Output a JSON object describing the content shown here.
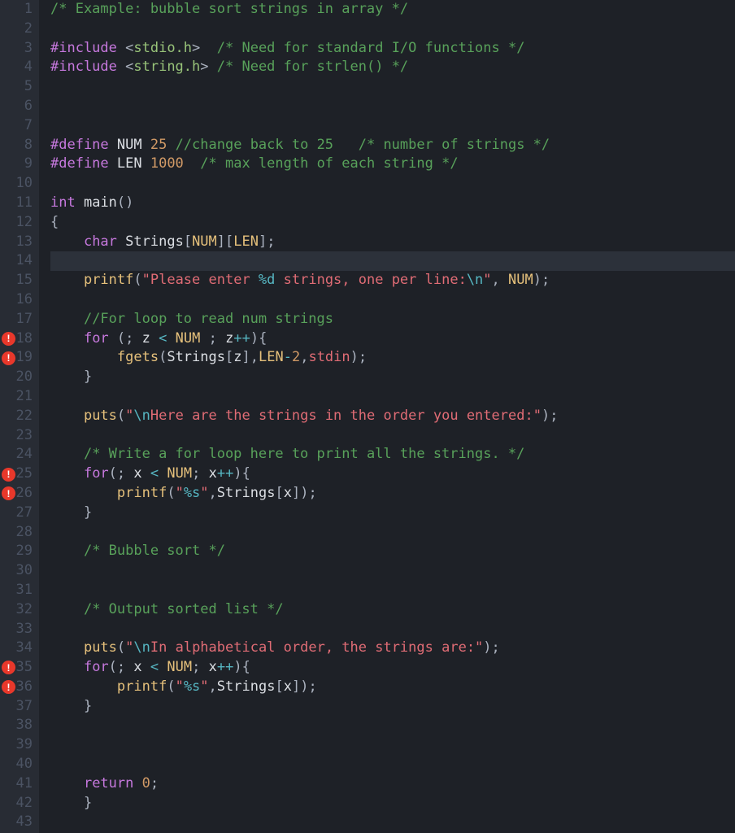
{
  "gutter": {
    "start": 1,
    "end": 43,
    "error_lines": [
      18,
      19,
      25,
      26,
      35,
      36
    ]
  },
  "cursor_line": 14,
  "code": {
    "lines": [
      {
        "n": 1,
        "t": [
          [
            "cmg",
            "/* Example: bubble sort strings in array */"
          ]
        ]
      },
      {
        "n": 2,
        "t": []
      },
      {
        "n": 3,
        "t": [
          [
            "kw",
            "#include "
          ],
          [
            "idw",
            "<"
          ],
          [
            "inc",
            "stdio.h"
          ],
          [
            "idw",
            ">"
          ],
          [
            "pw",
            "  "
          ],
          [
            "cmg",
            "/* Need for standard I/O functions */"
          ]
        ]
      },
      {
        "n": 4,
        "t": [
          [
            "kw",
            "#include "
          ],
          [
            "idw",
            "<"
          ],
          [
            "inc",
            "string.h"
          ],
          [
            "idw",
            ">"
          ],
          [
            "pw",
            " "
          ],
          [
            "cmg",
            "/* Need for strlen() */"
          ]
        ]
      },
      {
        "n": 5,
        "t": []
      },
      {
        "n": 6,
        "t": []
      },
      {
        "n": 7,
        "t": []
      },
      {
        "n": 8,
        "t": [
          [
            "kw",
            "#define "
          ],
          [
            "wt",
            "NUM "
          ],
          [
            "num",
            "25"
          ],
          [
            "pw",
            " "
          ],
          [
            "cmg",
            "//change back to 25   /* number of strings */"
          ]
        ]
      },
      {
        "n": 9,
        "t": [
          [
            "kw",
            "#define "
          ],
          [
            "wt",
            "LEN "
          ],
          [
            "num",
            "1000"
          ],
          [
            "pw",
            "  "
          ],
          [
            "cmg",
            "/* max length of each string */"
          ]
        ]
      },
      {
        "n": 10,
        "t": []
      },
      {
        "n": 11,
        "t": [
          [
            "ty",
            "int"
          ],
          [
            "pw",
            " "
          ],
          [
            "wt",
            "main"
          ],
          [
            "brw",
            "()"
          ]
        ]
      },
      {
        "n": 12,
        "t": [
          [
            "brw",
            "{"
          ]
        ]
      },
      {
        "n": 13,
        "t": [
          [
            "pw",
            "    "
          ],
          [
            "ty",
            "char"
          ],
          [
            "pw",
            " "
          ],
          [
            "wt",
            "Strings"
          ],
          [
            "brw",
            "["
          ],
          [
            "fn",
            "NUM"
          ],
          [
            "brw",
            "]["
          ],
          [
            "fn",
            "LEN"
          ],
          [
            "brw",
            "]"
          ],
          [
            "op",
            ";"
          ]
        ]
      },
      {
        "n": 14,
        "t": []
      },
      {
        "n": 15,
        "t": [
          [
            "pw",
            "    "
          ],
          [
            "fn",
            "printf"
          ],
          [
            "brw",
            "("
          ],
          [
            "str",
            "\"Please enter "
          ],
          [
            "esc",
            "%d"
          ],
          [
            "str",
            " strings, one per line:"
          ],
          [
            "esc",
            "\\n"
          ],
          [
            "str",
            "\""
          ],
          [
            "op",
            ", "
          ],
          [
            "fn",
            "NUM"
          ],
          [
            "brw",
            ")"
          ],
          [
            "op",
            ";"
          ]
        ]
      },
      {
        "n": 16,
        "t": []
      },
      {
        "n": 17,
        "t": [
          [
            "pw",
            "    "
          ],
          [
            "cmg",
            "//For loop to read num strings"
          ]
        ]
      },
      {
        "n": 18,
        "t": [
          [
            "pw",
            "    "
          ],
          [
            "kw",
            "for"
          ],
          [
            "pw",
            " "
          ],
          [
            "brw",
            "("
          ],
          [
            "op",
            "; "
          ],
          [
            "wt",
            "z"
          ],
          [
            "pw",
            " "
          ],
          [
            "opc",
            "<"
          ],
          [
            "pw",
            " "
          ],
          [
            "fn",
            "NUM"
          ],
          [
            "pw",
            " "
          ],
          [
            "op",
            "; "
          ],
          [
            "wt",
            "z"
          ],
          [
            "opc",
            "++"
          ],
          [
            "brw",
            ")"
          ],
          [
            "brw",
            "{"
          ]
        ]
      },
      {
        "n": 19,
        "t": [
          [
            "pw",
            "        "
          ],
          [
            "fn",
            "fgets"
          ],
          [
            "brw",
            "("
          ],
          [
            "wt",
            "Strings"
          ],
          [
            "brw",
            "["
          ],
          [
            "wt",
            "z"
          ],
          [
            "brw",
            "]"
          ],
          [
            "op",
            ","
          ],
          [
            "fn",
            "LEN"
          ],
          [
            "opc",
            "-"
          ],
          [
            "num",
            "2"
          ],
          [
            "op",
            ","
          ],
          [
            "id",
            "stdin"
          ],
          [
            "brw",
            ")"
          ],
          [
            "op",
            ";"
          ]
        ]
      },
      {
        "n": 20,
        "t": [
          [
            "pw",
            "    "
          ],
          [
            "brw",
            "}"
          ]
        ]
      },
      {
        "n": 21,
        "t": []
      },
      {
        "n": 22,
        "t": [
          [
            "pw",
            "    "
          ],
          [
            "fn",
            "puts"
          ],
          [
            "brw",
            "("
          ],
          [
            "str",
            "\""
          ],
          [
            "esc",
            "\\n"
          ],
          [
            "str",
            "Here are the strings in the order you entered:\""
          ],
          [
            "brw",
            ")"
          ],
          [
            "op",
            ";"
          ]
        ]
      },
      {
        "n": 23,
        "t": []
      },
      {
        "n": 24,
        "t": [
          [
            "pw",
            "    "
          ],
          [
            "cmg",
            "/* Write a for loop here to print all the strings. */"
          ]
        ]
      },
      {
        "n": 25,
        "t": [
          [
            "pw",
            "    "
          ],
          [
            "kw",
            "for"
          ],
          [
            "brw",
            "("
          ],
          [
            "op",
            "; "
          ],
          [
            "wt",
            "x"
          ],
          [
            "pw",
            " "
          ],
          [
            "opc",
            "<"
          ],
          [
            "pw",
            " "
          ],
          [
            "fn",
            "NUM"
          ],
          [
            "op",
            "; "
          ],
          [
            "wt",
            "x"
          ],
          [
            "opc",
            "++"
          ],
          [
            "brw",
            ")"
          ],
          [
            "brw",
            "{"
          ]
        ]
      },
      {
        "n": 26,
        "t": [
          [
            "pw",
            "        "
          ],
          [
            "fn",
            "printf"
          ],
          [
            "brw",
            "("
          ],
          [
            "str",
            "\""
          ],
          [
            "esc",
            "%s"
          ],
          [
            "str",
            "\""
          ],
          [
            "op",
            ","
          ],
          [
            "wt",
            "Strings"
          ],
          [
            "brw",
            "["
          ],
          [
            "wt",
            "x"
          ],
          [
            "brw",
            "]"
          ],
          [
            "brw",
            ")"
          ],
          [
            "op",
            ";"
          ]
        ]
      },
      {
        "n": 27,
        "t": [
          [
            "pw",
            "    "
          ],
          [
            "brw",
            "}"
          ]
        ]
      },
      {
        "n": 28,
        "t": []
      },
      {
        "n": 29,
        "t": [
          [
            "pw",
            "    "
          ],
          [
            "cmg",
            "/* Bubble sort */"
          ]
        ]
      },
      {
        "n": 30,
        "t": []
      },
      {
        "n": 31,
        "t": []
      },
      {
        "n": 32,
        "t": [
          [
            "pw",
            "    "
          ],
          [
            "cmg",
            "/* Output sorted list */"
          ]
        ]
      },
      {
        "n": 33,
        "t": []
      },
      {
        "n": 34,
        "t": [
          [
            "pw",
            "    "
          ],
          [
            "fn",
            "puts"
          ],
          [
            "brw",
            "("
          ],
          [
            "str",
            "\""
          ],
          [
            "esc",
            "\\n"
          ],
          [
            "str",
            "In alphabetical order, the strings are:\""
          ],
          [
            "brw",
            ")"
          ],
          [
            "op",
            ";"
          ]
        ]
      },
      {
        "n": 35,
        "t": [
          [
            "pw",
            "    "
          ],
          [
            "kw",
            "for"
          ],
          [
            "brw",
            "("
          ],
          [
            "op",
            "; "
          ],
          [
            "wt",
            "x"
          ],
          [
            "pw",
            " "
          ],
          [
            "opc",
            "<"
          ],
          [
            "pw",
            " "
          ],
          [
            "fn",
            "NUM"
          ],
          [
            "op",
            "; "
          ],
          [
            "wt",
            "x"
          ],
          [
            "opc",
            "++"
          ],
          [
            "brw",
            ")"
          ],
          [
            "brw",
            "{"
          ]
        ]
      },
      {
        "n": 36,
        "t": [
          [
            "pw",
            "        "
          ],
          [
            "fn",
            "printf"
          ],
          [
            "brw",
            "("
          ],
          [
            "str",
            "\""
          ],
          [
            "esc",
            "%s"
          ],
          [
            "str",
            "\""
          ],
          [
            "op",
            ","
          ],
          [
            "wt",
            "Strings"
          ],
          [
            "brw",
            "["
          ],
          [
            "wt",
            "x"
          ],
          [
            "brw",
            "]"
          ],
          [
            "brw",
            ")"
          ],
          [
            "op",
            ";"
          ]
        ]
      },
      {
        "n": 37,
        "t": [
          [
            "pw",
            "    "
          ],
          [
            "brw",
            "}"
          ]
        ]
      },
      {
        "n": 38,
        "t": []
      },
      {
        "n": 39,
        "t": []
      },
      {
        "n": 40,
        "t": []
      },
      {
        "n": 41,
        "t": [
          [
            "pw",
            "    "
          ],
          [
            "kw",
            "return"
          ],
          [
            "pw",
            " "
          ],
          [
            "num",
            "0"
          ],
          [
            "op",
            ";"
          ]
        ]
      },
      {
        "n": 42,
        "t": [
          [
            "pw",
            "    "
          ],
          [
            "brw",
            "}"
          ]
        ]
      },
      {
        "n": 43,
        "t": []
      }
    ]
  },
  "caret_under": {
    "18": [
      7
    ],
    "19": [
      25
    ],
    "25": [
      7
    ],
    "26": [
      38
    ],
    "35": [
      7
    ],
    "36": [
      38
    ]
  }
}
